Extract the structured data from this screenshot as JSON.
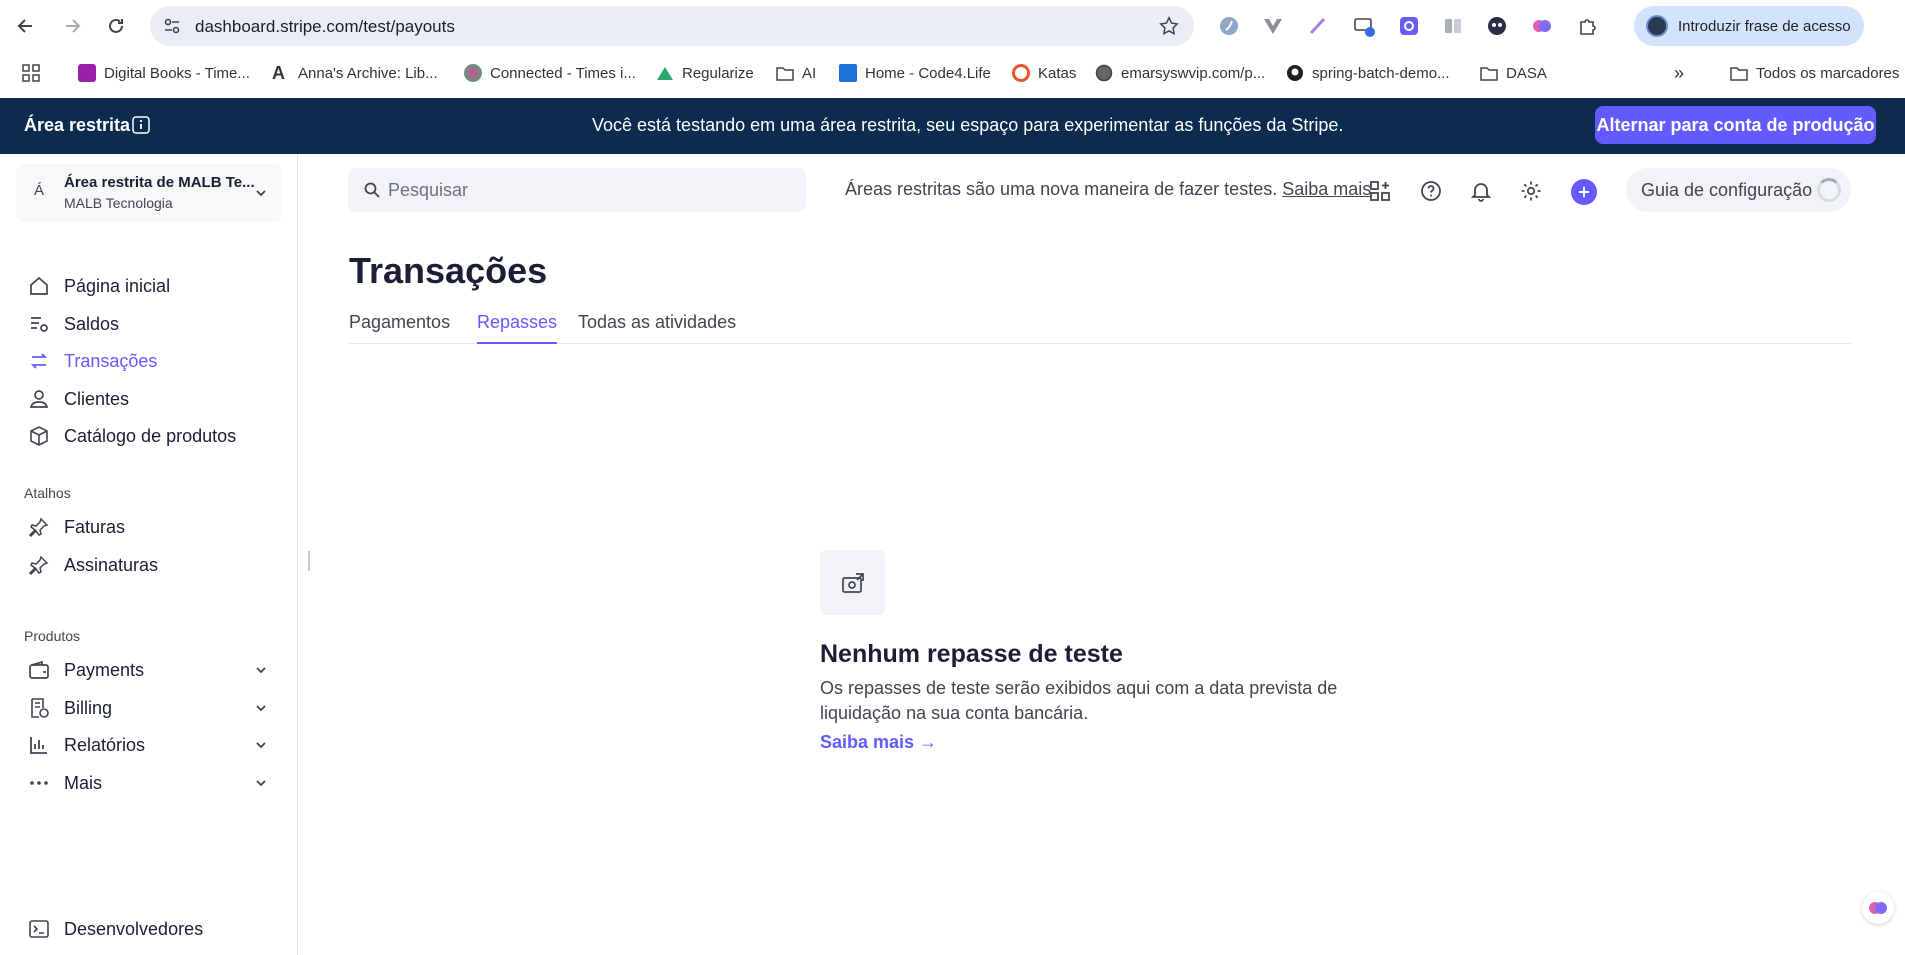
{
  "browser": {
    "url": "dashboard.stripe.com/test/payouts",
    "profile_label": "Introduzir frase de acesso",
    "bookmarks": [
      {
        "label": "Digital Books - Time...",
        "icon": "book-icon"
      },
      {
        "label": "Anna's Archive: Lib...",
        "icon": "anna-icon"
      },
      {
        "label": "Connected - Times i...",
        "icon": "connected-icon"
      },
      {
        "label": "Regularize",
        "icon": "regularize-icon"
      },
      {
        "label": "AI",
        "icon": "folder-icon"
      },
      {
        "label": "Home - Code4.Life",
        "icon": "code4life-icon"
      },
      {
        "label": "Katas",
        "icon": "katas-icon"
      },
      {
        "label": "emarsyswvip.com/p...",
        "icon": "globe-icon"
      },
      {
        "label": "spring-batch-demo...",
        "icon": "github-icon"
      },
      {
        "label": "DASA",
        "icon": "folder-icon"
      }
    ],
    "all_bookmarks_label": "Todos os marcadores",
    "more_bookmarks": "»"
  },
  "banner": {
    "title": "Área restrita",
    "message": "Você está testando em uma área restrita, seu espaço para experimentar as funções da Stripe.",
    "button": "Alternar para conta de produção"
  },
  "account": {
    "letter": "Á",
    "name": "Área restrita de MALB Te...",
    "subtitle": "MALB Tecnologia"
  },
  "sidebar": {
    "main_items": [
      {
        "label": "Página inicial",
        "icon": "home-icon"
      },
      {
        "label": "Saldos",
        "icon": "balances-icon"
      },
      {
        "label": "Transações",
        "icon": "transactions-icon",
        "active": true
      },
      {
        "label": "Clientes",
        "icon": "customers-icon"
      },
      {
        "label": "Catálogo de produtos",
        "icon": "product-catalog-icon"
      }
    ],
    "shortcuts_label": "Atalhos",
    "shortcuts": [
      {
        "label": "Faturas",
        "icon": "pin-icon"
      },
      {
        "label": "Assinaturas",
        "icon": "pin-icon"
      }
    ],
    "products_label": "Produtos",
    "products": [
      {
        "label": "Payments",
        "icon": "wallet-icon"
      },
      {
        "label": "Billing",
        "icon": "billing-icon"
      },
      {
        "label": "Relatórios",
        "icon": "reports-icon"
      },
      {
        "label": "Mais",
        "icon": "more-icon"
      }
    ],
    "developers": {
      "label": "Desenvolvedores",
      "icon": "terminal-icon"
    }
  },
  "topbar": {
    "search_placeholder": "Pesquisar",
    "sandbox_note": "Áreas restritas são uma nova maneira de fazer testes.",
    "sandbox_link": "Saiba mais",
    "guide_label": "Guia de configuração"
  },
  "page": {
    "title": "Transações",
    "tabs": [
      {
        "label": "Pagamentos"
      },
      {
        "label": "Repasses",
        "active": true
      },
      {
        "label": "Todas as atividades"
      }
    ]
  },
  "empty_state": {
    "title": "Nenhum repasse de teste",
    "description": "Os repasses de teste serão exibidos aqui com a data prevista de liquidação na sua conta bancária.",
    "link": "Saiba mais →"
  },
  "colors": {
    "accent": "#635bff",
    "banner_bg": "#0d2b4e"
  }
}
